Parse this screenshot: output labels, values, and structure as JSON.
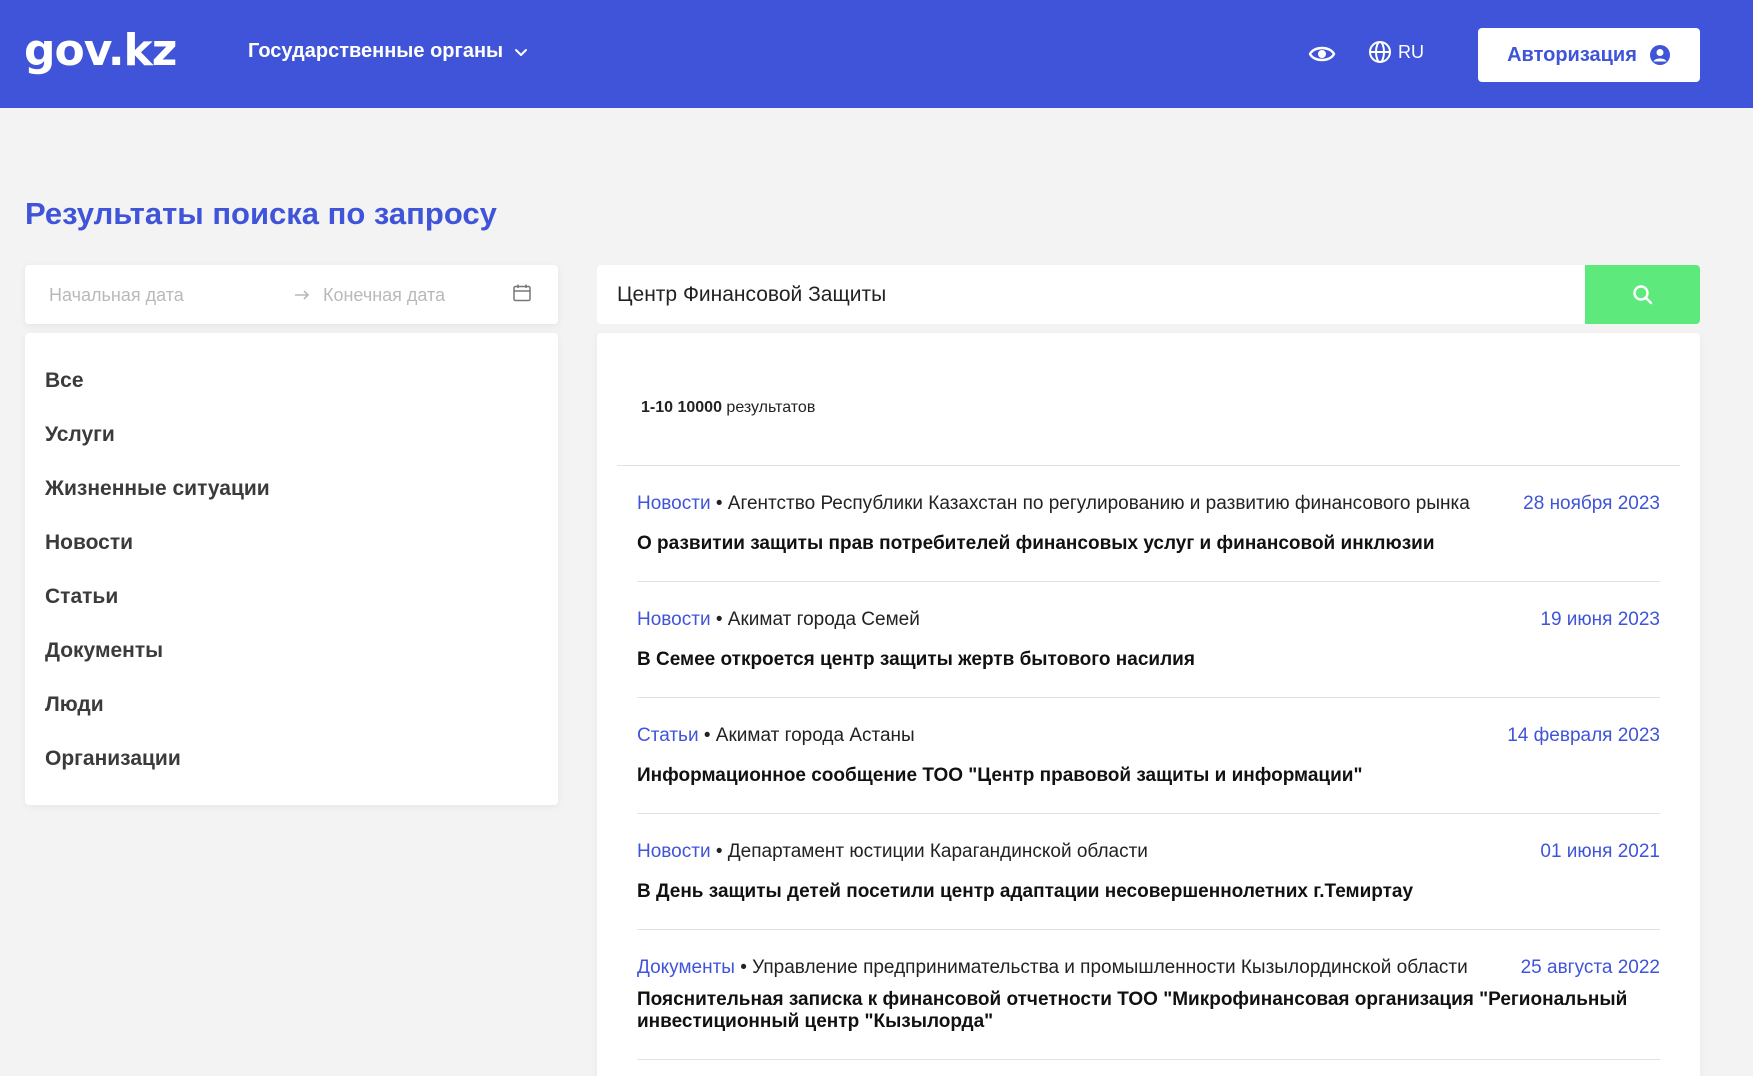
{
  "header": {
    "logo": "gov.kz",
    "gov_menu_label": "Государственные органы",
    "lang_label": "RU",
    "auth_label": "Авторизация"
  },
  "page": {
    "title": "Результаты поиска по запросу"
  },
  "date_range": {
    "start_placeholder": "Начальная дата",
    "end_placeholder": "Конечная дата"
  },
  "filters": [
    "Все",
    "Услуги",
    "Жизненные ситуации",
    "Новости",
    "Статьи",
    "Документы",
    "Люди",
    "Организации"
  ],
  "search": {
    "value": "Центр Финансовой Защиты"
  },
  "results_count": {
    "range": "1-10 10000",
    "suffix": " результатов"
  },
  "results": [
    {
      "category": "Новости",
      "source": "Агентство Республики Казахстан по регулированию и развитию финансового рынка",
      "date": "28 ноября 2023",
      "title": "О развитии защиты прав потребителей финансовых услуг и финансовой инклюзии"
    },
    {
      "category": "Новости",
      "source": "Акимат города Семей",
      "date": "19 июня 2023",
      "title": "В Семее откроется центр защиты жертв бытового насилия"
    },
    {
      "category": "Статьи",
      "source": "Акимат города Астаны",
      "date": "14 февраля 2023",
      "title": "Информационное сообщение ТОО \"Центр правовой защиты и информации\""
    },
    {
      "category": "Новости",
      "source": "Департамент юстиции Карагандинской области",
      "date": "01 июня 2021",
      "title": "В День защиты детей посетили центр адаптации несовершеннолетних  г.Темиртау"
    },
    {
      "category": "Документы",
      "source": "Управление предпринимательства и промышленности Кызылординской области",
      "date": "25 августа 2022",
      "title": "Пояснительная записка к финансовой отчетности ТОО \"Микрофинансовая организация \"Региональный инвестиционный центр \"Кызылорда\""
    }
  ]
}
